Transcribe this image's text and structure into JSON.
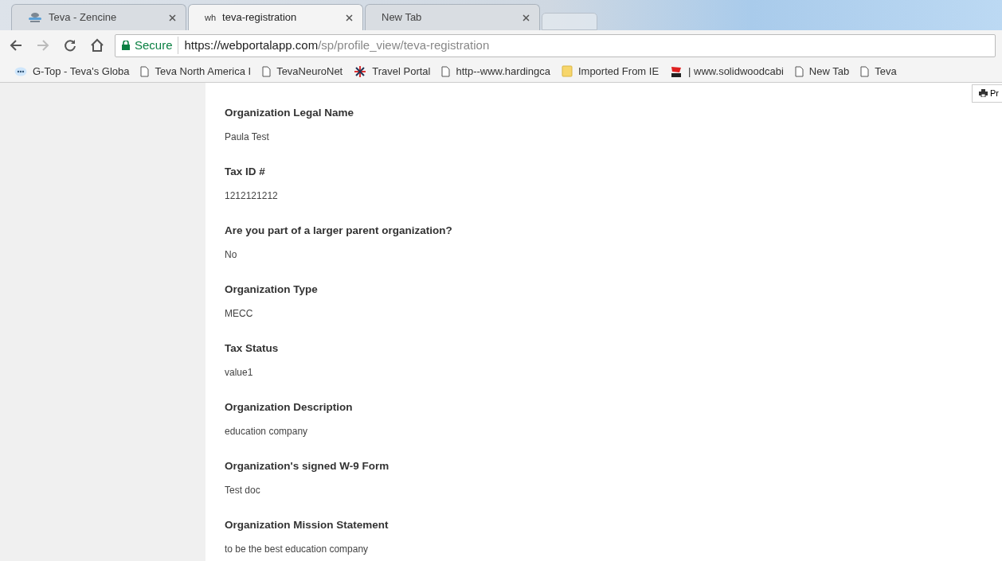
{
  "tabs": [
    {
      "title": "Teva - Zencine",
      "kind": "cloud",
      "selected": false
    },
    {
      "title": "teva-registration",
      "kind": "lettered",
      "favicon_text": "wh",
      "selected": true
    },
    {
      "title": "New Tab",
      "kind": "blank",
      "selected": false
    }
  ],
  "address_bar": {
    "secure_label": "Secure",
    "url_host": "https://webportalapp.com",
    "url_path": "/sp/profile_view/teva-registration"
  },
  "bookmarks": [
    {
      "label": "G-Top - Teva's Globa",
      "kind": "badge"
    },
    {
      "label": "Teva North America I",
      "kind": "page"
    },
    {
      "label": "TevaNeuroNet",
      "kind": "page"
    },
    {
      "label": "Travel Portal",
      "kind": "asterisk"
    },
    {
      "label": "http--www.hardingca",
      "kind": "page"
    },
    {
      "label": "Imported From IE",
      "kind": "folder"
    },
    {
      "label": "| www.solidwoodcabi",
      "kind": "logo"
    },
    {
      "label": "New Tab",
      "kind": "page"
    },
    {
      "label": "Teva",
      "kind": "page"
    }
  ],
  "print_button": {
    "label": "Pr"
  },
  "fields": [
    {
      "label": "Organization Legal Name",
      "value": "Paula Test"
    },
    {
      "label": "Tax ID #",
      "value": "1212121212"
    },
    {
      "label": "Are you part of a larger parent organization?",
      "value": "No"
    },
    {
      "label": "Organization Type",
      "value": "MECC"
    },
    {
      "label": "Tax Status",
      "value": "value1"
    },
    {
      "label": "Organization Description",
      "value": "education company"
    },
    {
      "label": "Organization's signed W-9 Form",
      "value": "Test doc"
    },
    {
      "label": "Organization Mission Statement",
      "value": "to be the best education company"
    }
  ]
}
